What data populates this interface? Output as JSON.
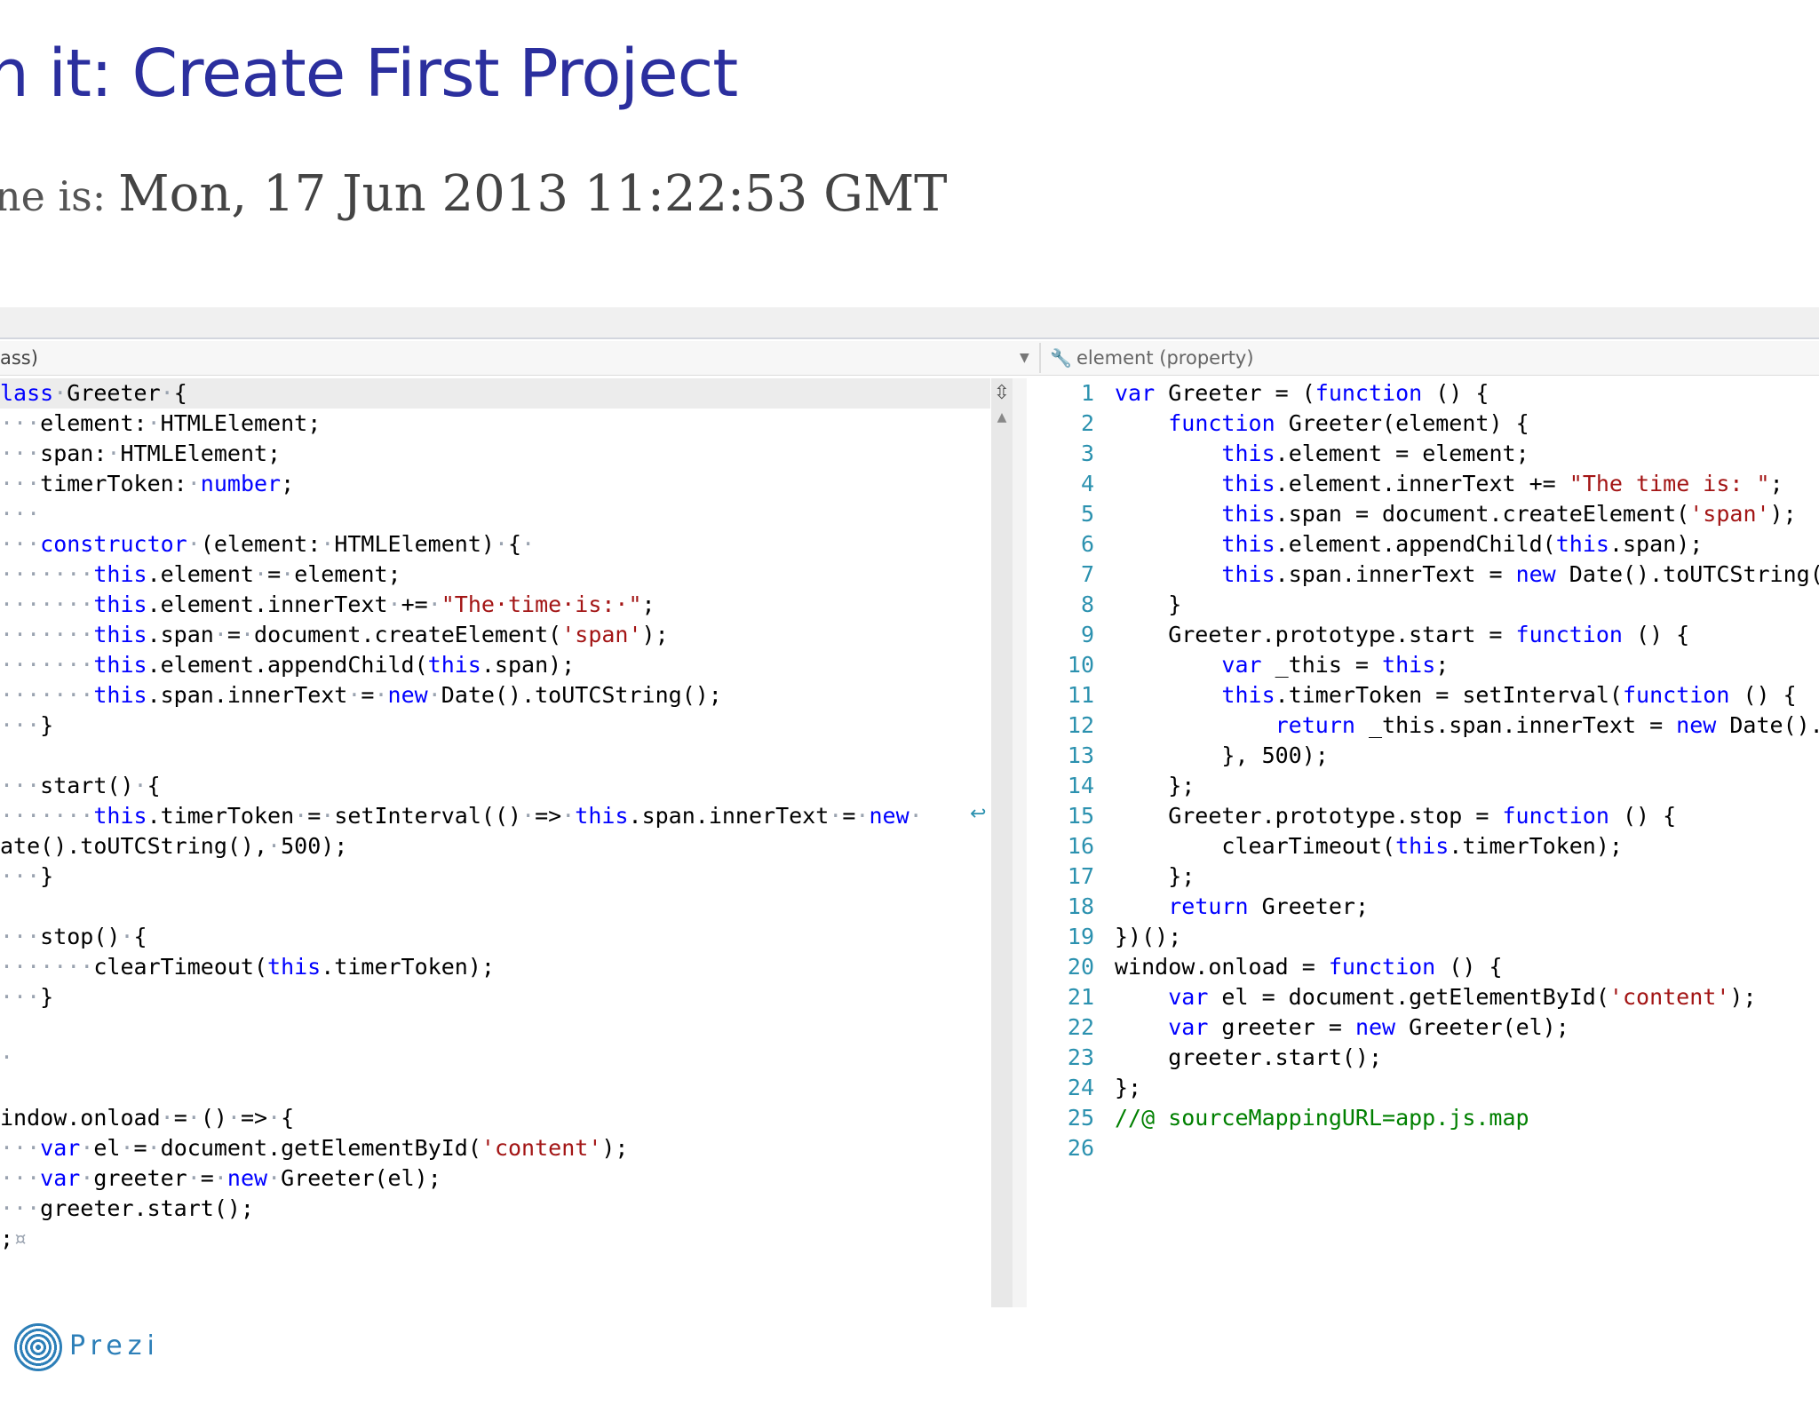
{
  "slide": {
    "title": "n it: Create First Project",
    "time_prefix": "ne is:",
    "time_value": "Mon, 17 Jun 2013 11:22:53 GMT"
  },
  "navbar": {
    "left_label": "ass)",
    "right_label": "element (property)",
    "right_icon": "wrench-icon"
  },
  "ts_code": [
    [
      [
        "kw",
        "lass"
      ],
      [
        "ws",
        "·"
      ],
      [
        "t",
        "Greeter"
      ],
      [
        "ws",
        "·"
      ],
      [
        "t",
        "{"
      ]
    ],
    [
      [
        "ws",
        "···"
      ],
      [
        "t",
        "element:"
      ],
      [
        "ws",
        "·"
      ],
      [
        "t",
        "HTMLElement;"
      ]
    ],
    [
      [
        "ws",
        "···"
      ],
      [
        "t",
        "span:"
      ],
      [
        "ws",
        "·"
      ],
      [
        "t",
        "HTMLElement;"
      ]
    ],
    [
      [
        "ws",
        "···"
      ],
      [
        "t",
        "timerToken:"
      ],
      [
        "ws",
        "·"
      ],
      [
        "kw",
        "number"
      ],
      [
        "t",
        ";"
      ]
    ],
    [
      [
        "ws",
        "···"
      ]
    ],
    [
      [
        "ws",
        "···"
      ],
      [
        "kw",
        "constructor"
      ],
      [
        "ws",
        "·"
      ],
      [
        "t",
        "(element:"
      ],
      [
        "ws",
        "·"
      ],
      [
        "t",
        "HTMLElement)"
      ],
      [
        "ws",
        "·"
      ],
      [
        "t",
        "{"
      ],
      [
        "ws",
        "·"
      ]
    ],
    [
      [
        "ws",
        "·······"
      ],
      [
        "kw",
        "this"
      ],
      [
        "t",
        ".element"
      ],
      [
        "ws",
        "·"
      ],
      [
        "t",
        "="
      ],
      [
        "ws",
        "·"
      ],
      [
        "t",
        "element;"
      ]
    ],
    [
      [
        "ws",
        "·······"
      ],
      [
        "kw",
        "this"
      ],
      [
        "t",
        ".element.innerText"
      ],
      [
        "ws",
        "·"
      ],
      [
        "t",
        "+="
      ],
      [
        "ws",
        "·"
      ],
      [
        "str",
        "\"The·time·is:·\""
      ],
      [
        "t",
        ";"
      ]
    ],
    [
      [
        "ws",
        "·······"
      ],
      [
        "kw",
        "this"
      ],
      [
        "t",
        ".span"
      ],
      [
        "ws",
        "·"
      ],
      [
        "t",
        "="
      ],
      [
        "ws",
        "·"
      ],
      [
        "t",
        "document.createElement("
      ],
      [
        "str",
        "'span'"
      ],
      [
        "t",
        ");"
      ]
    ],
    [
      [
        "ws",
        "·······"
      ],
      [
        "kw",
        "this"
      ],
      [
        "t",
        ".element.appendChild("
      ],
      [
        "kw",
        "this"
      ],
      [
        "t",
        ".span);"
      ]
    ],
    [
      [
        "ws",
        "·······"
      ],
      [
        "kw",
        "this"
      ],
      [
        "t",
        ".span.innerText"
      ],
      [
        "ws",
        "·"
      ],
      [
        "t",
        "="
      ],
      [
        "ws",
        "·"
      ],
      [
        "kw",
        "new"
      ],
      [
        "ws",
        "·"
      ],
      [
        "t",
        "Date().toUTCString();"
      ]
    ],
    [
      [
        "ws",
        "···"
      ],
      [
        "t",
        "}"
      ]
    ],
    [],
    [
      [
        "ws",
        "···"
      ],
      [
        "t",
        "start()"
      ],
      [
        "ws",
        "·"
      ],
      [
        "t",
        "{"
      ]
    ],
    [
      [
        "ws",
        "·······"
      ],
      [
        "kw",
        "this"
      ],
      [
        "t",
        ".timerToken"
      ],
      [
        "ws",
        "·"
      ],
      [
        "t",
        "="
      ],
      [
        "ws",
        "·"
      ],
      [
        "t",
        "setInterval(()"
      ],
      [
        "ws",
        "·"
      ],
      [
        "t",
        "=>"
      ],
      [
        "ws",
        "·"
      ],
      [
        "kw",
        "this"
      ],
      [
        "t",
        ".span.innerText"
      ],
      [
        "ws",
        "·"
      ],
      [
        "t",
        "="
      ],
      [
        "ws",
        "·"
      ],
      [
        "kw",
        "new"
      ],
      [
        "ws",
        "·"
      ]
    ],
    [
      [
        "t",
        "ate().toUTCString(),"
      ],
      [
        "ws",
        "·"
      ],
      [
        "t",
        "500);"
      ]
    ],
    [
      [
        "ws",
        "···"
      ],
      [
        "t",
        "}"
      ]
    ],
    [],
    [
      [
        "ws",
        "···"
      ],
      [
        "t",
        "stop()"
      ],
      [
        "ws",
        "·"
      ],
      [
        "t",
        "{"
      ]
    ],
    [
      [
        "ws",
        "·······"
      ],
      [
        "t",
        "clearTimeout("
      ],
      [
        "kw",
        "this"
      ],
      [
        "t",
        ".timerToken);"
      ]
    ],
    [
      [
        "ws",
        "···"
      ],
      [
        "t",
        "}"
      ]
    ],
    [],
    [
      [
        "ws",
        "·"
      ]
    ],
    [],
    [
      [
        "t",
        "indow.onload"
      ],
      [
        "ws",
        "·"
      ],
      [
        "t",
        "="
      ],
      [
        "ws",
        "·"
      ],
      [
        "t",
        "()"
      ],
      [
        "ws",
        "·"
      ],
      [
        "t",
        "=>"
      ],
      [
        "ws",
        "·"
      ],
      [
        "t",
        "{"
      ]
    ],
    [
      [
        "ws",
        "···"
      ],
      [
        "kw",
        "var"
      ],
      [
        "ws",
        "·"
      ],
      [
        "t",
        "el"
      ],
      [
        "ws",
        "·"
      ],
      [
        "t",
        "="
      ],
      [
        "ws",
        "·"
      ],
      [
        "t",
        "document.getElementById("
      ],
      [
        "str",
        "'content'"
      ],
      [
        "t",
        ");"
      ]
    ],
    [
      [
        "ws",
        "···"
      ],
      [
        "kw",
        "var"
      ],
      [
        "ws",
        "·"
      ],
      [
        "t",
        "greeter"
      ],
      [
        "ws",
        "·"
      ],
      [
        "t",
        "="
      ],
      [
        "ws",
        "·"
      ],
      [
        "kw",
        "new"
      ],
      [
        "ws",
        "·"
      ],
      [
        "t",
        "Greeter(el);"
      ]
    ],
    [
      [
        "ws",
        "···"
      ],
      [
        "t",
        "greeter.start();"
      ]
    ],
    [
      [
        "t",
        ";"
      ],
      [
        "ws",
        "¤"
      ]
    ]
  ],
  "js_line_numbers": [
    "1",
    "2",
    "3",
    "4",
    "5",
    "6",
    "7",
    "8",
    "9",
    "10",
    "11",
    "12",
    "13",
    "14",
    "15",
    "16",
    "17",
    "18",
    "19",
    "20",
    "21",
    "22",
    "23",
    "24",
    "25",
    "26"
  ],
  "js_code": [
    [
      [
        "kw",
        "var"
      ],
      [
        "t",
        " Greeter = ("
      ],
      [
        "kw",
        "function"
      ],
      [
        "t",
        " () {"
      ]
    ],
    [
      [
        "t",
        "    "
      ],
      [
        "kw",
        "function"
      ],
      [
        "t",
        " Greeter(element) {"
      ]
    ],
    [
      [
        "t",
        "        "
      ],
      [
        "kw",
        "this"
      ],
      [
        "t",
        ".element = element;"
      ]
    ],
    [
      [
        "t",
        "        "
      ],
      [
        "kw",
        "this"
      ],
      [
        "t",
        ".element.innerText += "
      ],
      [
        "str",
        "\"The time is: \""
      ],
      [
        "t",
        ";"
      ]
    ],
    [
      [
        "t",
        "        "
      ],
      [
        "kw",
        "this"
      ],
      [
        "t",
        ".span = document.createElement("
      ],
      [
        "str",
        "'span'"
      ],
      [
        "t",
        ");"
      ]
    ],
    [
      [
        "t",
        "        "
      ],
      [
        "kw",
        "this"
      ],
      [
        "t",
        ".element.appendChild("
      ],
      [
        "kw",
        "this"
      ],
      [
        "t",
        ".span);"
      ]
    ],
    [
      [
        "t",
        "        "
      ],
      [
        "kw",
        "this"
      ],
      [
        "t",
        ".span.innerText = "
      ],
      [
        "kw",
        "new"
      ],
      [
        "t",
        " Date().toUTCString("
      ]
    ],
    [
      [
        "t",
        "    }"
      ]
    ],
    [
      [
        "t",
        "    Greeter.prototype.start = "
      ],
      [
        "kw",
        "function"
      ],
      [
        "t",
        " () {"
      ]
    ],
    [
      [
        "t",
        "        "
      ],
      [
        "kw",
        "var"
      ],
      [
        "t",
        " _this = "
      ],
      [
        "kw",
        "this"
      ],
      [
        "t",
        ";"
      ]
    ],
    [
      [
        "t",
        "        "
      ],
      [
        "kw",
        "this"
      ],
      [
        "t",
        ".timerToken = setInterval("
      ],
      [
        "kw",
        "function"
      ],
      [
        "t",
        " () {"
      ]
    ],
    [
      [
        "t",
        "            "
      ],
      [
        "kw",
        "return"
      ],
      [
        "t",
        " _this.span.innerText = "
      ],
      [
        "kw",
        "new"
      ],
      [
        "t",
        " Date()."
      ]
    ],
    [
      [
        "t",
        "        }, 500);"
      ]
    ],
    [
      [
        "t",
        "    };"
      ]
    ],
    [
      [
        "t",
        "    Greeter.prototype.stop = "
      ],
      [
        "kw",
        "function"
      ],
      [
        "t",
        " () {"
      ]
    ],
    [
      [
        "t",
        "        clearTimeout("
      ],
      [
        "kw",
        "this"
      ],
      [
        "t",
        ".timerToken);"
      ]
    ],
    [
      [
        "t",
        "    };"
      ]
    ],
    [
      [
        "t",
        "    "
      ],
      [
        "kw",
        "return"
      ],
      [
        "t",
        " Greeter;"
      ]
    ],
    [
      [
        "t",
        "})();"
      ]
    ],
    [
      [
        "t",
        "window.onload = "
      ],
      [
        "kw",
        "function"
      ],
      [
        "t",
        " () {"
      ]
    ],
    [
      [
        "t",
        "    "
      ],
      [
        "kw",
        "var"
      ],
      [
        "t",
        " el = document.getElementById("
      ],
      [
        "str",
        "'content'"
      ],
      [
        "t",
        ");"
      ]
    ],
    [
      [
        "t",
        "    "
      ],
      [
        "kw",
        "var"
      ],
      [
        "t",
        " greeter = "
      ],
      [
        "kw",
        "new"
      ],
      [
        "t",
        " Greeter(el);"
      ]
    ],
    [
      [
        "t",
        "    greeter.start();"
      ]
    ],
    [
      [
        "t",
        "};"
      ]
    ],
    [
      [
        "cmt",
        "//@ sourceMappingURL=app.js.map"
      ]
    ],
    []
  ],
  "logo": {
    "text": "Prezi",
    "icon": "prezi-logo-icon"
  },
  "colors": {
    "title": "#2b2f9e",
    "keyword": "#0000ff",
    "string": "#a31515",
    "comment": "#008000",
    "line_number": "#2b91af"
  }
}
